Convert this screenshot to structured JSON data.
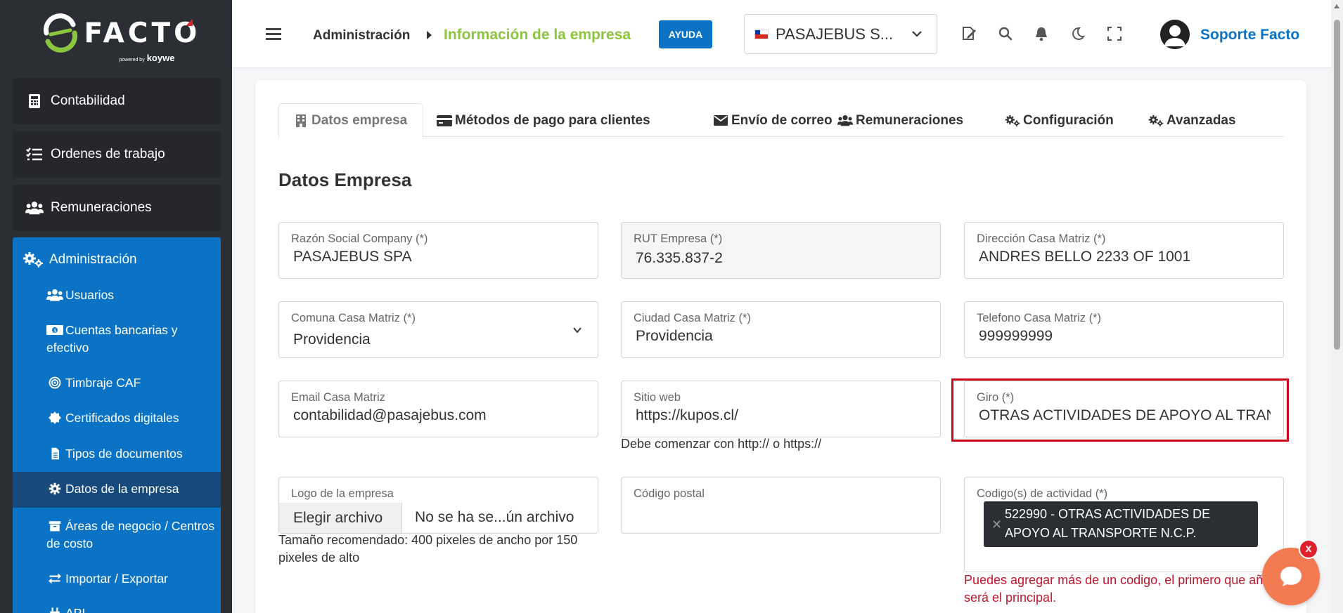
{
  "brand": {
    "name": "FACTO",
    "powered_by": "powered by",
    "partner": "koywe",
    "accent": "#0a73c6",
    "green": "#8cc63f"
  },
  "sidebar": {
    "items": [
      {
        "label": "Contabilidad",
        "icon": "calculator-icon"
      },
      {
        "label": "Ordenes de trabajo",
        "icon": "tasks-icon"
      },
      {
        "label": "Remuneraciones",
        "icon": "users-icon"
      }
    ],
    "admin": {
      "label": "Administración",
      "icon": "cogs-icon",
      "children": [
        {
          "label": "Usuarios",
          "icon": "users-icon"
        },
        {
          "label": "Cuentas bancarias y efectivo",
          "icon": "money-icon"
        },
        {
          "label": "Timbraje CAF",
          "icon": "target-icon"
        },
        {
          "label": "Certificados digitales",
          "icon": "certificate-icon"
        },
        {
          "label": "Tipos de documentos",
          "icon": "file-icon"
        },
        {
          "label": "Datos de la empresa",
          "icon": "gear-icon",
          "active": true
        },
        {
          "label": "Áreas de negocio / Centros de costo",
          "icon": "archive-icon"
        },
        {
          "label": "Importar / Exportar",
          "icon": "exchange-icon"
        },
        {
          "label": "API",
          "icon": "plug-icon"
        }
      ]
    }
  },
  "header": {
    "breadcrumb_parent": "Administración",
    "breadcrumb_current": "Información de la empresa",
    "help_label": "AYUDA",
    "company_selected": "PASAJEBUS S...",
    "user_name": "Soporte Facto"
  },
  "tabs": [
    {
      "label": "Datos empresa",
      "icon": "building-icon",
      "active": true
    },
    {
      "label": "Métodos de pago para clientes",
      "icon": "credit-card-icon"
    },
    {
      "label": "Envío de correo",
      "icon": "envelope-icon"
    },
    {
      "label": "Remuneraciones",
      "icon": "users-icon"
    },
    {
      "label": "Configuración",
      "icon": "cogs-icon"
    },
    {
      "label": "Avanzadas",
      "icon": "cogs-icon"
    }
  ],
  "form": {
    "title": "Datos Empresa",
    "razon_social": {
      "label": "Razón Social Company (*)",
      "value": "PASAJEBUS SPA"
    },
    "rut": {
      "label": "RUT Empresa (*)",
      "value": "76.335.837-2"
    },
    "direccion": {
      "label": "Dirección Casa Matriz (*)",
      "value": "ANDRES BELLO 2233 OF 1001"
    },
    "comuna": {
      "label": "Comuna Casa Matriz (*)",
      "value": "Providencia"
    },
    "ciudad": {
      "label": "Ciudad Casa Matriz (*)",
      "value": "Providencia"
    },
    "telefono": {
      "label": "Telefono Casa Matriz (*)",
      "value": "999999999"
    },
    "email": {
      "label": "Email Casa Matriz",
      "value": "contabilidad@pasajebus.com"
    },
    "sitio_web": {
      "label": "Sitio web",
      "value": "https://kupos.cl/",
      "hint": "Debe comenzar con http:// o https://"
    },
    "giro": {
      "label": "Giro (*)",
      "value": "OTRAS ACTIVIDADES DE APOYO AL TRAN"
    },
    "logo": {
      "label": "Logo de la empresa",
      "button": "Elegir archivo",
      "status": "No se ha se...ún archivo",
      "hint": "Tamaño recomendado: 400 pixeles de ancho por 150 pixeles de alto"
    },
    "codigo_postal": {
      "label": "Código postal",
      "value": ""
    },
    "actividad": {
      "label": "Codigo(s) de actividad (*)",
      "tag": "522990 - OTRAS ACTIVIDADES DE APOYO AL TRANSPORTE N.C.P.",
      "hint": "Puedes agregar más de un codigo, el primero que añadas será el principal."
    }
  },
  "chat": {
    "close_label": "x"
  }
}
